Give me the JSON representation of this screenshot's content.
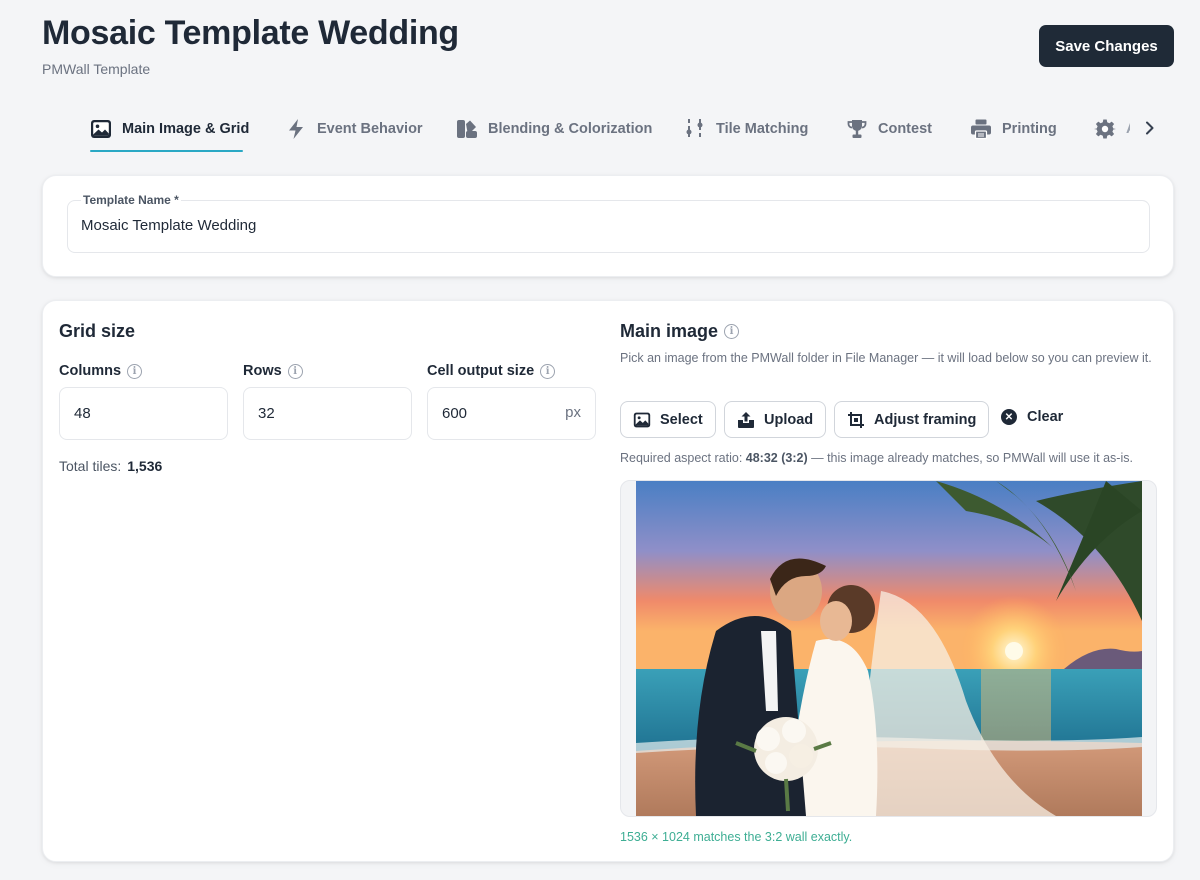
{
  "header": {
    "title": "Mosaic Template Wedding",
    "subtitle": "PMWall Template",
    "save_label": "Save Changes"
  },
  "tabs": [
    {
      "label": "Main Image & Grid",
      "icon": "image-icon",
      "active": true
    },
    {
      "label": "Event Behavior",
      "icon": "bolt-icon"
    },
    {
      "label": "Blending & Colorization",
      "icon": "swatches-icon"
    },
    {
      "label": "Tile Matching",
      "icon": "sliders-icon"
    },
    {
      "label": "Contest",
      "icon": "trophy-icon"
    },
    {
      "label": "Printing",
      "icon": "printer-icon"
    },
    {
      "label": "A",
      "icon": "gear-icon"
    }
  ],
  "template_name": {
    "label": "Template Name *",
    "value": "Mosaic Template Wedding"
  },
  "grid": {
    "title": "Grid size",
    "columns_label": "Columns",
    "columns_value": "48",
    "rows_label": "Rows",
    "rows_value": "32",
    "cell_label": "Cell output size",
    "cell_value": "600",
    "cell_unit": "px",
    "total_label": "Total tiles:",
    "total_value": "1,536"
  },
  "main_image": {
    "title": "Main image",
    "description": "Pick an image from the PMWall folder in File Manager — it will load below so you can preview it.",
    "select_label": "Select",
    "upload_label": "Upload",
    "adjust_label": "Adjust framing",
    "clear_label": "Clear",
    "aspect_prefix": "Required aspect ratio:",
    "aspect_value": "48:32 (3:2)",
    "aspect_suffix": "— this image already matches, so PMWall will use it as-is.",
    "match_note": "1536 × 1024 matches the 3:2 wall exactly."
  }
}
